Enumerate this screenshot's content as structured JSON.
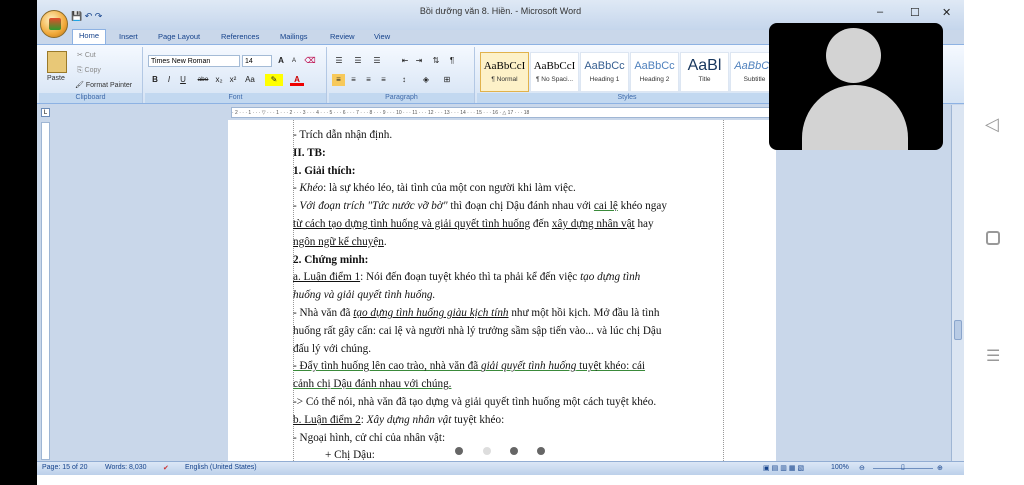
{
  "window": {
    "title": "Bồi dưỡng văn 8. Hiền. - Microsoft Word",
    "controls": [
      "–",
      "☐",
      "✕"
    ]
  },
  "tabs": [
    "Home",
    "Insert",
    "Page Layout",
    "References",
    "Mailings",
    "Review",
    "View"
  ],
  "clipboard": {
    "paste": "Paste",
    "cut": "Cut",
    "copy": "Copy",
    "format_painter": "Format Painter",
    "label": "Clipboard"
  },
  "font": {
    "name": "Times New Roman",
    "size": "14",
    "label": "Font",
    "bold": "B",
    "italic": "I",
    "underline": "U",
    "strike": "abe",
    "sub": "x₂",
    "sup": "x²",
    "case": "Aa",
    "grow": "A",
    "shrink": "A"
  },
  "paragraph": {
    "label": "Paragraph"
  },
  "styles": {
    "label": "Styles",
    "items": [
      {
        "preview": "AaBbCcI",
        "name": "¶ Normal"
      },
      {
        "preview": "AaBbCcI",
        "name": "¶ No Spaci..."
      },
      {
        "preview": "AaBbCc",
        "name": "Heading 1"
      },
      {
        "preview": "AaBbCc",
        "name": "Heading 2"
      },
      {
        "preview": "AaBl",
        "name": "Title"
      },
      {
        "preview": "AaBbCc",
        "name": "Subtitle"
      }
    ]
  },
  "doc": {
    "lines": [
      "- Trích dẫn nhận định.",
      "II. TB:",
      "1. Giải thích:",
      "Khéo",
      ": là sự khéo léo, tài tình của một con người khi làm việc.",
      "Với đoạn trích \"Tức nước vỡ bờ\"",
      " thì đoạn chị Dậu đánh nhau với ",
      "cai lệ",
      " khéo ngay",
      "từ cách tạo dựng tình huống và giải quyết tình huống",
      " đến ",
      "xây dựng nhân vật",
      " hay",
      "ngôn ngữ kể chuyện",
      ".",
      "2. Chứng minh:",
      "a. Luận điểm 1",
      ": Nói đến đoạn tuyệt khéo thì ta phải kể đến việc ",
      "tạo dựng tình",
      "huống và giải quyết tình huống.",
      "- Nhà văn đã ",
      "tạo dựng tình huống giàu kịch tính",
      " như một hồi kịch. Mở đầu là tình",
      "huống rất gây cấn: cai lệ và người nhà lý trưởng sầm sập tiến vào... và lúc chị Dậu",
      "đấu lý với chúng.",
      "- Đẩy tình huống lên cao trào, nhà văn đã ",
      "giải quyết tình huống",
      " tuyệt khéo: cái",
      "cảnh chị Dậu đánh nhau với chúng.",
      "-> Có thể nói, nhà văn đã tạo dựng và giải quyết tình huống một cách tuyệt khéo.",
      "b. Luận điểm 2",
      ": ",
      "Xây dựng nhân vật",
      " tuyệt khéo:",
      "- Ngoại hình, cử chỉ của nhân vật:",
      "+ Chị Dậu:"
    ]
  },
  "status": {
    "page": "Page: 15 of 20",
    "words": "Words: 8,030",
    "language": "English (United States)",
    "zoom": "100%"
  }
}
